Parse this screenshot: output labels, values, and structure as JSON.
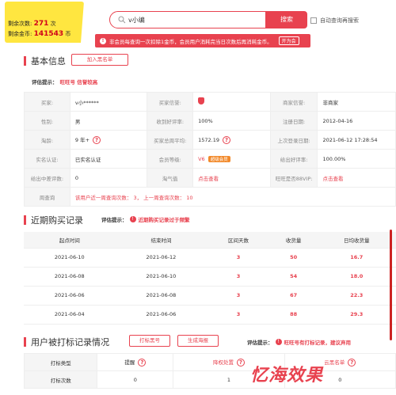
{
  "quota": {
    "remaining_label": "剩余次数:",
    "remaining_value": "271",
    "remaining_unit": "次",
    "coins_label": "剩余金币:",
    "coins_value": "141543",
    "coins_unit": "币"
  },
  "search": {
    "value": "v小编",
    "button": "搜索",
    "auto_save_label": "自动查询再搜索"
  },
  "notice": {
    "text": "非会员每查询一次扣除1金币，会员用户消耗完当日次数后再消耗金币。",
    "button": "开为会"
  },
  "basic": {
    "title": "基本信息",
    "add_button": "加入黑名单",
    "tip_label": "评估提示：",
    "tip_text": "旺旺号 信誉较高",
    "rows": [
      [
        {
          "k": "买家:",
          "v": "v小******"
        },
        {
          "k": "买家信誉:",
          "v": ""
        },
        {
          "k": "商家信誉:",
          "v": "非商家"
        }
      ],
      [
        {
          "k": "性别:",
          "v": "男"
        },
        {
          "k": "收到好评率:",
          "v": "100%"
        },
        {
          "k": "注册日期:",
          "v": "2012-04-16"
        }
      ],
      [
        {
          "k": "淘龄:",
          "v": "9 年+"
        },
        {
          "k": "买家总周平均:",
          "v": "1572.19"
        },
        {
          "k": "上次登录日期:",
          "v": "2021-06-12 17:28:54"
        }
      ],
      [
        {
          "k": "实名认证:",
          "v": "已实名认证"
        },
        {
          "k": "会员等级:",
          "v": "V6"
        },
        {
          "k": "给出好评率:",
          "v": "100.00%"
        }
      ],
      [
        {
          "k": "给出中差评数:",
          "v": "0"
        },
        {
          "k": "淘气值",
          "v": "点击查看"
        },
        {
          "k": "旺旺是否88VIP:",
          "v": "点击查看"
        }
      ]
    ],
    "member_badge": "超级会员",
    "query_label": "周查询",
    "query_text": "该用户近一周查询次数： 3， 上一周查询次数： 10"
  },
  "purchase": {
    "title": "近期购买记录",
    "tip_label": "评估提示：",
    "tip_text": "近期购买记录过于频繁",
    "headers": [
      "起点时间",
      "结束时间",
      "区间天数",
      "收货量",
      "日均收货量"
    ],
    "rows": [
      [
        "2021-06-10",
        "2021-06-12",
        "3",
        "50",
        "16.7"
      ],
      [
        "2021-06-08",
        "2021-06-10",
        "3",
        "54",
        "18.0"
      ],
      [
        "2021-06-06",
        "2021-06-08",
        "3",
        "67",
        "22.3"
      ],
      [
        "2021-06-04",
        "2021-06-06",
        "3",
        "88",
        "29.3"
      ]
    ]
  },
  "report": {
    "title": "用户被打标记录情况",
    "button1": "打标黑号",
    "button2": "生成海报",
    "tip_label": "评估提示：",
    "tip_text": "旺旺号有打标记录，建议弃用",
    "row1": [
      "打标类型",
      "提醒",
      "降权处置",
      "云黑名单"
    ],
    "row2": [
      "打标次数",
      "0",
      "1",
      "0"
    ]
  },
  "watermark": "忆海效果",
  "colors": {
    "accent": "#e8424f",
    "quota_bg": "#ffe640"
  }
}
